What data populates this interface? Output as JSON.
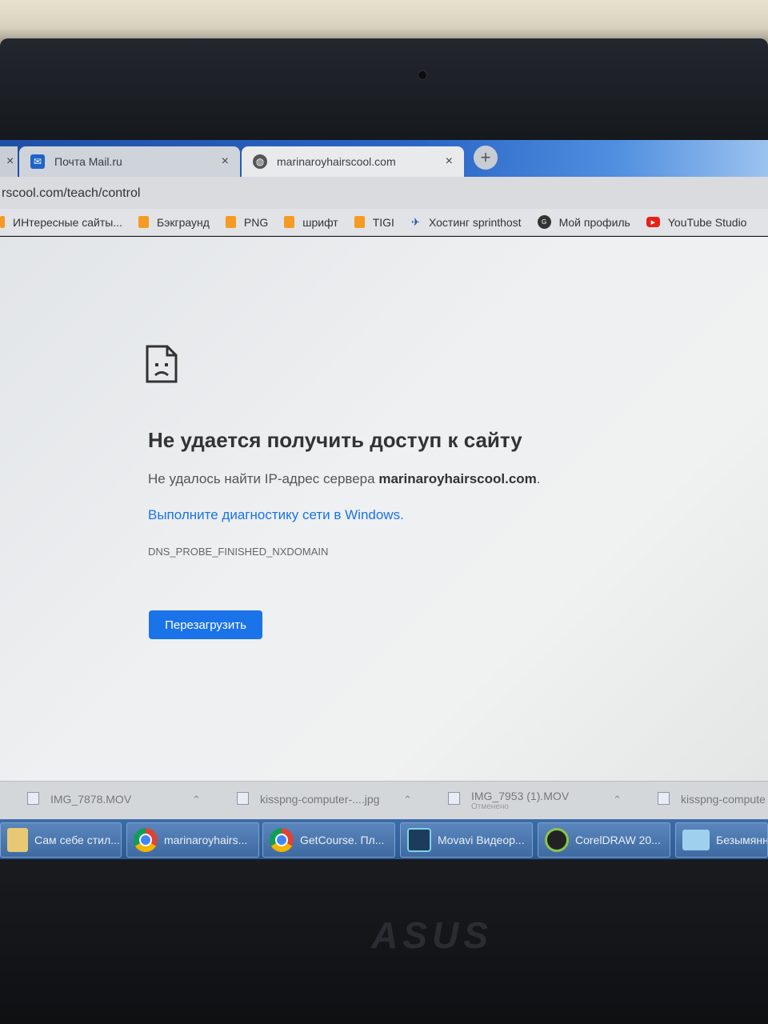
{
  "browser": {
    "tabs": [
      {
        "label": "Почта Mail.ru",
        "active": false
      },
      {
        "label": "marinaroyhairscool.com",
        "active": true
      }
    ],
    "partial_tab_close": "×",
    "new_tab": "+",
    "address": "rscool.com/teach/control",
    "bookmarks": [
      {
        "label": "ИНтересные сайты...",
        "icon": "folder-icon"
      },
      {
        "label": "Бэкграунд",
        "icon": "folder-icon"
      },
      {
        "label": "PNG",
        "icon": "folder-icon"
      },
      {
        "label": "шрифт",
        "icon": "folder-icon"
      },
      {
        "label": "TIGI",
        "icon": "folder-icon"
      },
      {
        "label": "Хостинг sprinthost",
        "icon": "sprinthost-icon"
      },
      {
        "label": "Мой профиль",
        "icon": "profile-icon"
      },
      {
        "label": "YouTube Studio",
        "icon": "youtube-icon"
      }
    ]
  },
  "error_page": {
    "title": "Не удается получить доступ к сайту",
    "desc_prefix": "Не удалось найти IP-адрес сервера ",
    "desc_domain": "marinaroyhairscool.com",
    "desc_suffix": ".",
    "diagnostics_link": "Выполните диагностику сети в Windows.",
    "error_code": "DNS_PROBE_FINISHED_NXDOMAIN",
    "reload_button": "Перезагрузить"
  },
  "downloads": [
    {
      "name": "IMG_7878.MOV",
      "status": ""
    },
    {
      "name": "kisspng-computer-....jpg",
      "status": ""
    },
    {
      "name": "IMG_7953 (1).MOV",
      "status": "Отменено"
    },
    {
      "name": "kisspng-compute",
      "status": ""
    }
  ],
  "taskbar": [
    {
      "label": "Сам себе стил...",
      "icon": "folder-icon"
    },
    {
      "label": "marinaroyhairs...",
      "icon": "chrome-icon"
    },
    {
      "label": "GetCourse. Пл...",
      "icon": "chrome-icon"
    },
    {
      "label": "Movavi Видеор...",
      "icon": "movavi-icon"
    },
    {
      "label": "CorelDRAW 20...",
      "icon": "coreldraw-icon"
    },
    {
      "label": "Безымянн",
      "icon": "paint-icon"
    }
  ],
  "laptop_brand": "ASUS",
  "colors": {
    "link": "#1a73e8",
    "button": "#1a73e8",
    "taskbar": "#2b5a93"
  }
}
